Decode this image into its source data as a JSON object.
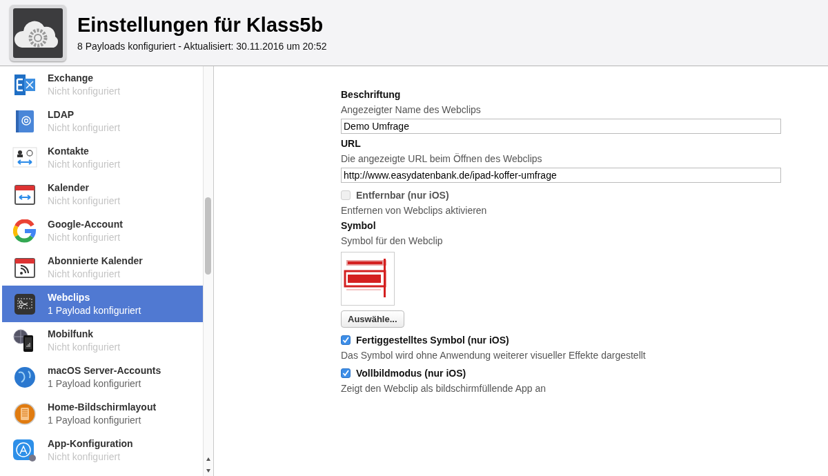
{
  "header": {
    "title": "Einstellungen für Klass5b",
    "subtitle": "8 Payloads konfiguriert - Aktualisiert: 30.11.2016 um 20:52"
  },
  "sidebar": {
    "items": [
      {
        "title": "Exchange",
        "status": "Nicht konfiguriert",
        "selected": false
      },
      {
        "title": "LDAP",
        "status": "Nicht konfiguriert",
        "selected": false
      },
      {
        "title": "Kontakte",
        "status": "Nicht konfiguriert",
        "selected": false
      },
      {
        "title": "Kalender",
        "status": "Nicht konfiguriert",
        "selected": false
      },
      {
        "title": "Google-Account",
        "status": "Nicht konfiguriert",
        "selected": false
      },
      {
        "title": "Abonnierte Kalender",
        "status": "Nicht konfiguriert",
        "selected": false
      },
      {
        "title": "Webclips",
        "status": "1 Payload konfiguriert",
        "selected": true
      },
      {
        "title": "Mobilfunk",
        "status": "Nicht konfiguriert",
        "selected": false
      },
      {
        "title": "macOS Server-Accounts",
        "status": "1 Payload konfiguriert",
        "selected": false
      },
      {
        "title": "Home-Bildschirmlayout",
        "status": "1 Payload konfiguriert",
        "selected": false
      },
      {
        "title": "App-Konfiguration",
        "status": "Nicht konfiguriert",
        "selected": false
      }
    ]
  },
  "form": [
    {
      "kind": "text",
      "label": "Beschriftung",
      "hint": "Angezeigter Name des Webclips",
      "value": "Demo Umfrage"
    },
    {
      "kind": "text",
      "label": "URL",
      "hint": "Die angezeigte URL beim Öffnen des Webclips",
      "value": "http://www.easydatenbank.de/ipad-koffer-umfrage"
    },
    {
      "kind": "checkbox",
      "label": "Entfernbar (nur iOS)",
      "hint": "Entfernen von Webclips aktivieren",
      "checked": false,
      "disabled": true
    },
    {
      "label": "Symbol",
      "hint": "Symbol für den Webclip",
      "button": "Auswähle..."
    },
    {
      "kind": "checkbox",
      "label": "Fertiggestelltes Symbol (nur iOS)",
      "hint": "Das Symbol wird ohne Anwendung weiterer visueller Effekte dargestellt",
      "checked": true,
      "disabled": false
    },
    {
      "kind": "checkbox",
      "label": "Vollbildmodus (nur iOS)",
      "hint": "Zeigt den Webclip als bildschirmfüllende App an",
      "checked": true,
      "disabled": false
    }
  ]
}
